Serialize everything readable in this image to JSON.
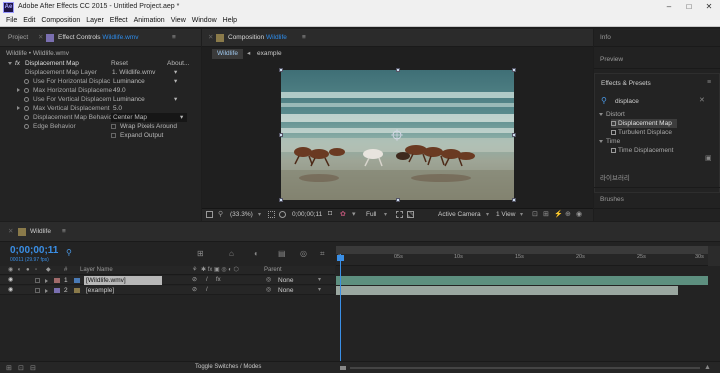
{
  "window": {
    "title": "Adobe After Effects CC 2015 - Untitled Project.aep *",
    "logo": "Ae",
    "buttons": [
      "–",
      "□",
      "✕"
    ]
  },
  "menu": [
    "File",
    "Edit",
    "Composition",
    "Layer",
    "Effect",
    "Animation",
    "View",
    "Window",
    "Help"
  ],
  "project_tab": "Project",
  "effect_controls": {
    "tab_prefix": "Effect Controls",
    "tab_name": "Wildlife.wmv",
    "breadcrumb": "Wildlife • Wildlife.wmv",
    "effect_name": "Displacement Map",
    "reset": "Reset",
    "about": "About...",
    "properties": [
      {
        "label": "Displacement Map Layer",
        "value": "1. Wildlife.wmv",
        "kind": "dropdown"
      },
      {
        "label": "Use For Horizontal Displac",
        "value": "Luminance",
        "kind": "dropdown"
      },
      {
        "label": "Max Horizontal Displaceme",
        "value": "49.0",
        "kind": "number"
      },
      {
        "label": "Use For Vertical Displacem",
        "value": "Luminance",
        "kind": "dropdown"
      },
      {
        "label": "Max Vertical Displacement",
        "value": "5.0",
        "kind": "number"
      },
      {
        "label": "Displacement Map Behavio",
        "value": "Center Map",
        "kind": "dropdown-active"
      },
      {
        "label": "Edge Behavior",
        "value": "Wrap Pixels Around",
        "kind": "checkbox"
      },
      {
        "label": "",
        "value": "Expand Output",
        "kind": "checkbox"
      }
    ]
  },
  "composition": {
    "tab_prefix": "Composition",
    "tab_name": "Wildlife",
    "sub_tabs": [
      "Wildlife",
      "example"
    ],
    "zoom": "(33.3%)",
    "timecode": "0;00;00;11",
    "resolution": "Full",
    "camera": "Active Camera",
    "views": "1 View"
  },
  "right_panel": {
    "items": [
      "Info",
      "Preview"
    ],
    "effects_title": "Effects & Presets",
    "search_value": "displace",
    "tree": [
      {
        "label": "Distort",
        "level": 0
      },
      {
        "label": "Displacement Map",
        "level": 1,
        "selected": true
      },
      {
        "label": "Turbulent Displace",
        "level": 1
      },
      {
        "label": "Time",
        "level": 0
      },
      {
        "label": "Time Displacement",
        "level": 1
      }
    ],
    "library": "라이브러리",
    "brushes": "Brushes"
  },
  "timeline": {
    "tab_name": "Wildlife",
    "timecode": "0;00;00;11",
    "frame_info": "00011 (29.97 fps)",
    "col_num": "#",
    "col_layer": "Layer Name",
    "col_parent": "Parent",
    "layers": [
      {
        "num": "1",
        "name": "[Wildlife.wmv]",
        "parent": "None",
        "selected": true
      },
      {
        "num": "2",
        "name": "[example]",
        "parent": "None",
        "selected": false
      }
    ],
    "ticks": [
      "0s",
      "05s",
      "10s",
      "15s",
      "20s",
      "25s",
      "30s"
    ],
    "footer": "Toggle Switches / Modes",
    "playhead_position": 0.01
  }
}
